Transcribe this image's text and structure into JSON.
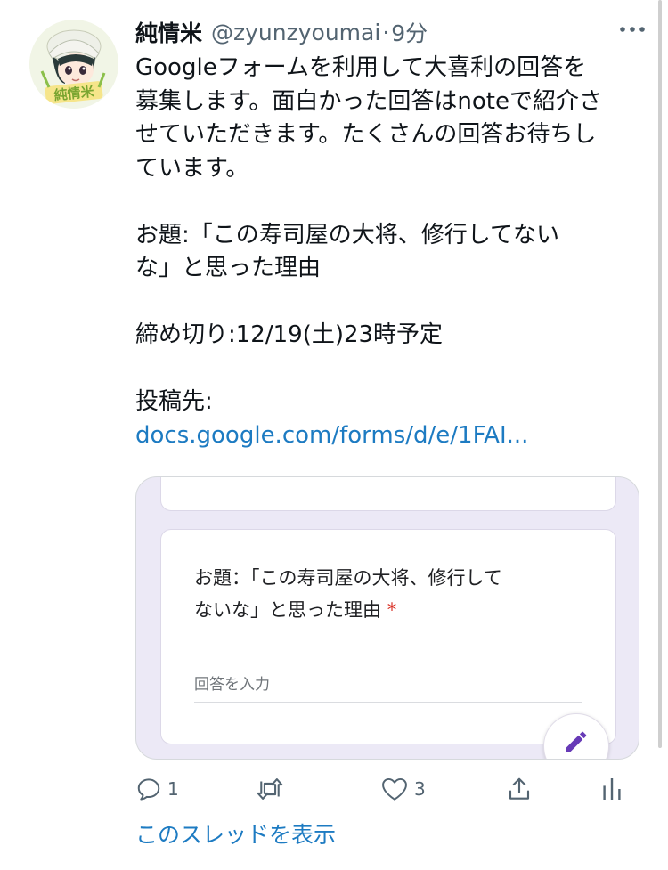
{
  "tweet": {
    "display_name": "純情米",
    "handle": "@zyunzyoumai",
    "separator": "·",
    "time": "9分",
    "body": {
      "line_1": "Googleフォームを利用して大喜利の回答を",
      "line_2": "募集します。面白かった回答はnoteで紹介さ",
      "line_3": "せていただきます。たくさんの回答お待ちし",
      "line_4": "ています。",
      "odai_line_1": "お題:「この寿司屋の大将、修行してない",
      "odai_line_2": "な」と思った理由",
      "deadline": "締め切り:12/19(土)23時予定",
      "post_to_label": "投稿先:",
      "link": "docs.google.com/forms/d/e/1FAI..."
    }
  },
  "card": {
    "question_line_1": "お題：「この寿司屋の大将、修行して",
    "question_line_2": "ないな」と思った理由",
    "required_mark": "*",
    "answer_placeholder": "回答を入力"
  },
  "actions": {
    "reply_count": "1",
    "retweet_count": "",
    "like_count": "3"
  },
  "thread_link": "このスレッドを表示",
  "icons": [
    "avatar-image",
    "more-icon",
    "reply-icon",
    "retweet-icon",
    "like-icon",
    "share-icon",
    "analytics-icon",
    "pencil-icon"
  ],
  "colors": {
    "link": "#1d7bc2",
    "secondary_text": "#536471",
    "card_background": "#ece9f6",
    "required": "#d93025",
    "edit_icon": "#673ab7"
  }
}
